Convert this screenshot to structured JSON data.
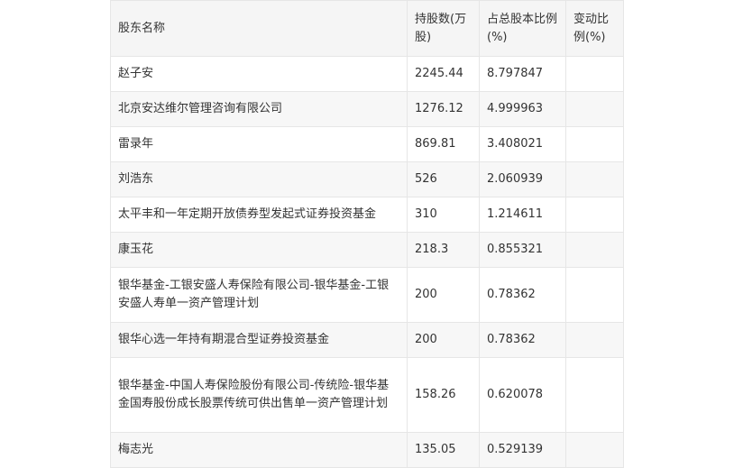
{
  "table": {
    "headers": [
      "股东名称",
      "持股数(万股)",
      "占总股本比例(%)",
      "变动比例(%)"
    ],
    "rows": [
      {
        "name": "赵子安",
        "shares": "2245.44",
        "ratio": "8.797847",
        "change": ""
      },
      {
        "name": "北京安达维尔管理咨询有限公司",
        "shares": "1276.12",
        "ratio": "4.999963",
        "change": ""
      },
      {
        "name": "雷录年",
        "shares": "869.81",
        "ratio": "3.408021",
        "change": ""
      },
      {
        "name": "刘浩东",
        "shares": "526",
        "ratio": "2.060939",
        "change": ""
      },
      {
        "name": "太平丰和一年定期开放债券型发起式证券投资基金",
        "shares": "310",
        "ratio": "1.214611",
        "change": ""
      },
      {
        "name": "康玉花",
        "shares": "218.3",
        "ratio": "0.855321",
        "change": ""
      },
      {
        "name": "银华基金-工银安盛人寿保险有限公司-银华基金-工银安盛人寿单一资产管理计划",
        "shares": "200",
        "ratio": "0.78362",
        "change": ""
      },
      {
        "name": "银华心选一年持有期混合型证券投资基金",
        "shares": "200",
        "ratio": "0.78362",
        "change": ""
      },
      {
        "name": "银华基金-中国人寿保险股份有限公司-传统险-银华基金国寿股份成长股票传统可供出售单一资产管理计划",
        "shares": "158.26",
        "ratio": "0.620078",
        "change": ""
      },
      {
        "name": "梅志光",
        "shares": "135.05",
        "ratio": "0.529139",
        "change": ""
      }
    ]
  }
}
